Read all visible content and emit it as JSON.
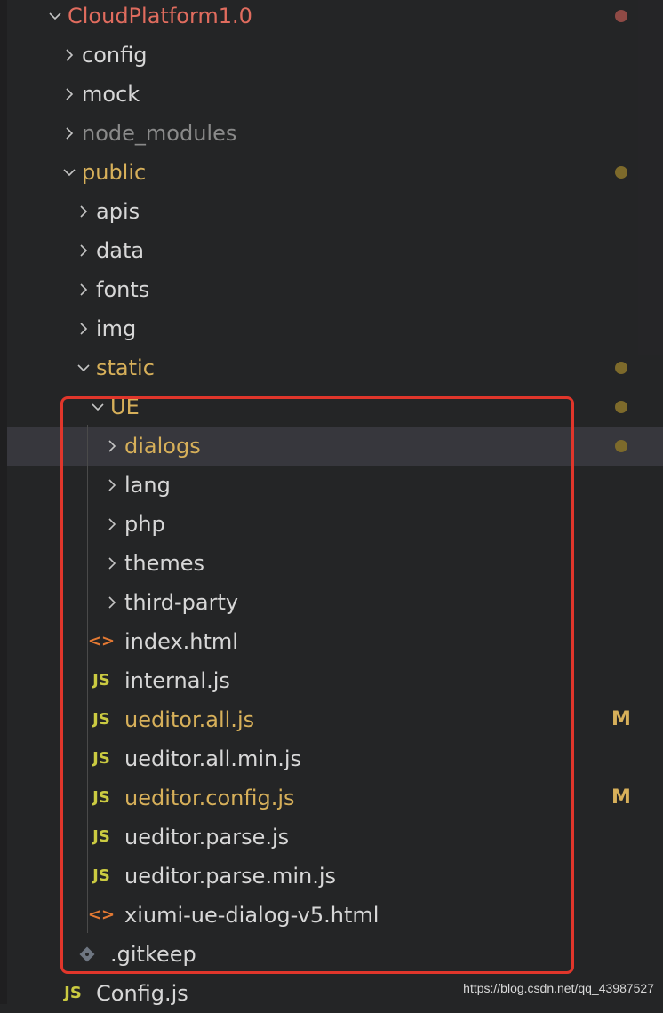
{
  "colors": {
    "background": "#242526",
    "selected_row": "#37373d",
    "folder_text": "#d7d7d7",
    "modified_text": "#d7b05a",
    "root_text": "#e06c5e",
    "ignored_text": "#8a8a8a",
    "git_dot_modified": "#7d6a2b",
    "git_dot_root": "#8f4a45",
    "js_icon": "#cbcb41",
    "html_icon": "#e37933",
    "highlight_border": "#e0362b"
  },
  "tree": {
    "root": {
      "label": "CloudPlatform1.0",
      "expanded": true,
      "state": "root"
    },
    "items": [
      {
        "label": "config",
        "type": "folder",
        "expanded": false,
        "depth": 1,
        "state": "normal"
      },
      {
        "label": "mock",
        "type": "folder",
        "expanded": false,
        "depth": 1,
        "state": "normal"
      },
      {
        "label": "node_modules",
        "type": "folder",
        "expanded": false,
        "depth": 1,
        "state": "ignored"
      },
      {
        "label": "public",
        "type": "folder",
        "expanded": true,
        "depth": 1,
        "state": "modified"
      },
      {
        "label": "apis",
        "type": "folder",
        "expanded": false,
        "depth": 2,
        "state": "normal"
      },
      {
        "label": "data",
        "type": "folder",
        "expanded": false,
        "depth": 2,
        "state": "normal"
      },
      {
        "label": "fonts",
        "type": "folder",
        "expanded": false,
        "depth": 2,
        "state": "normal"
      },
      {
        "label": "img",
        "type": "folder",
        "expanded": false,
        "depth": 2,
        "state": "normal"
      },
      {
        "label": "static",
        "type": "folder",
        "expanded": true,
        "depth": 2,
        "state": "modified"
      },
      {
        "label": "UE",
        "type": "folder",
        "expanded": true,
        "depth": 3,
        "state": "modified"
      },
      {
        "label": "dialogs",
        "type": "folder",
        "expanded": false,
        "depth": 4,
        "state": "modified",
        "selected": true
      },
      {
        "label": "lang",
        "type": "folder",
        "expanded": false,
        "depth": 4,
        "state": "normal"
      },
      {
        "label": "php",
        "type": "folder",
        "expanded": false,
        "depth": 4,
        "state": "normal"
      },
      {
        "label": "themes",
        "type": "folder",
        "expanded": false,
        "depth": 4,
        "state": "normal"
      },
      {
        "label": "third-party",
        "type": "folder",
        "expanded": false,
        "depth": 4,
        "state": "normal"
      },
      {
        "label": "index.html",
        "type": "html",
        "depth": 4,
        "state": "normal"
      },
      {
        "label": "internal.js",
        "type": "js",
        "depth": 4,
        "state": "normal"
      },
      {
        "label": "ueditor.all.js",
        "type": "js",
        "depth": 4,
        "state": "modified",
        "badge": "M"
      },
      {
        "label": "ueditor.all.min.js",
        "type": "js",
        "depth": 4,
        "state": "normal"
      },
      {
        "label": "ueditor.config.js",
        "type": "js",
        "depth": 4,
        "state": "modified",
        "badge": "M"
      },
      {
        "label": "ueditor.parse.js",
        "type": "js",
        "depth": 4,
        "state": "normal"
      },
      {
        "label": "ueditor.parse.min.js",
        "type": "js",
        "depth": 4,
        "state": "normal"
      },
      {
        "label": "xiumi-ue-dialog-v5.html",
        "type": "html",
        "depth": 4,
        "state": "normal"
      },
      {
        "label": ".gitkeep",
        "type": "git",
        "depth": 3,
        "state": "normal"
      },
      {
        "label": "Config.js",
        "type": "js",
        "depth": 2,
        "state": "normal"
      }
    ]
  },
  "icons": {
    "chevron_right": "chevron-right-icon",
    "chevron_down": "chevron-down-icon",
    "js": "js-file-icon",
    "html": "html-file-icon",
    "git": "git-file-icon",
    "js_glyph": "JS",
    "html_glyph": "<>"
  },
  "watermark": "https://blog.csdn.net/qq_43987527"
}
